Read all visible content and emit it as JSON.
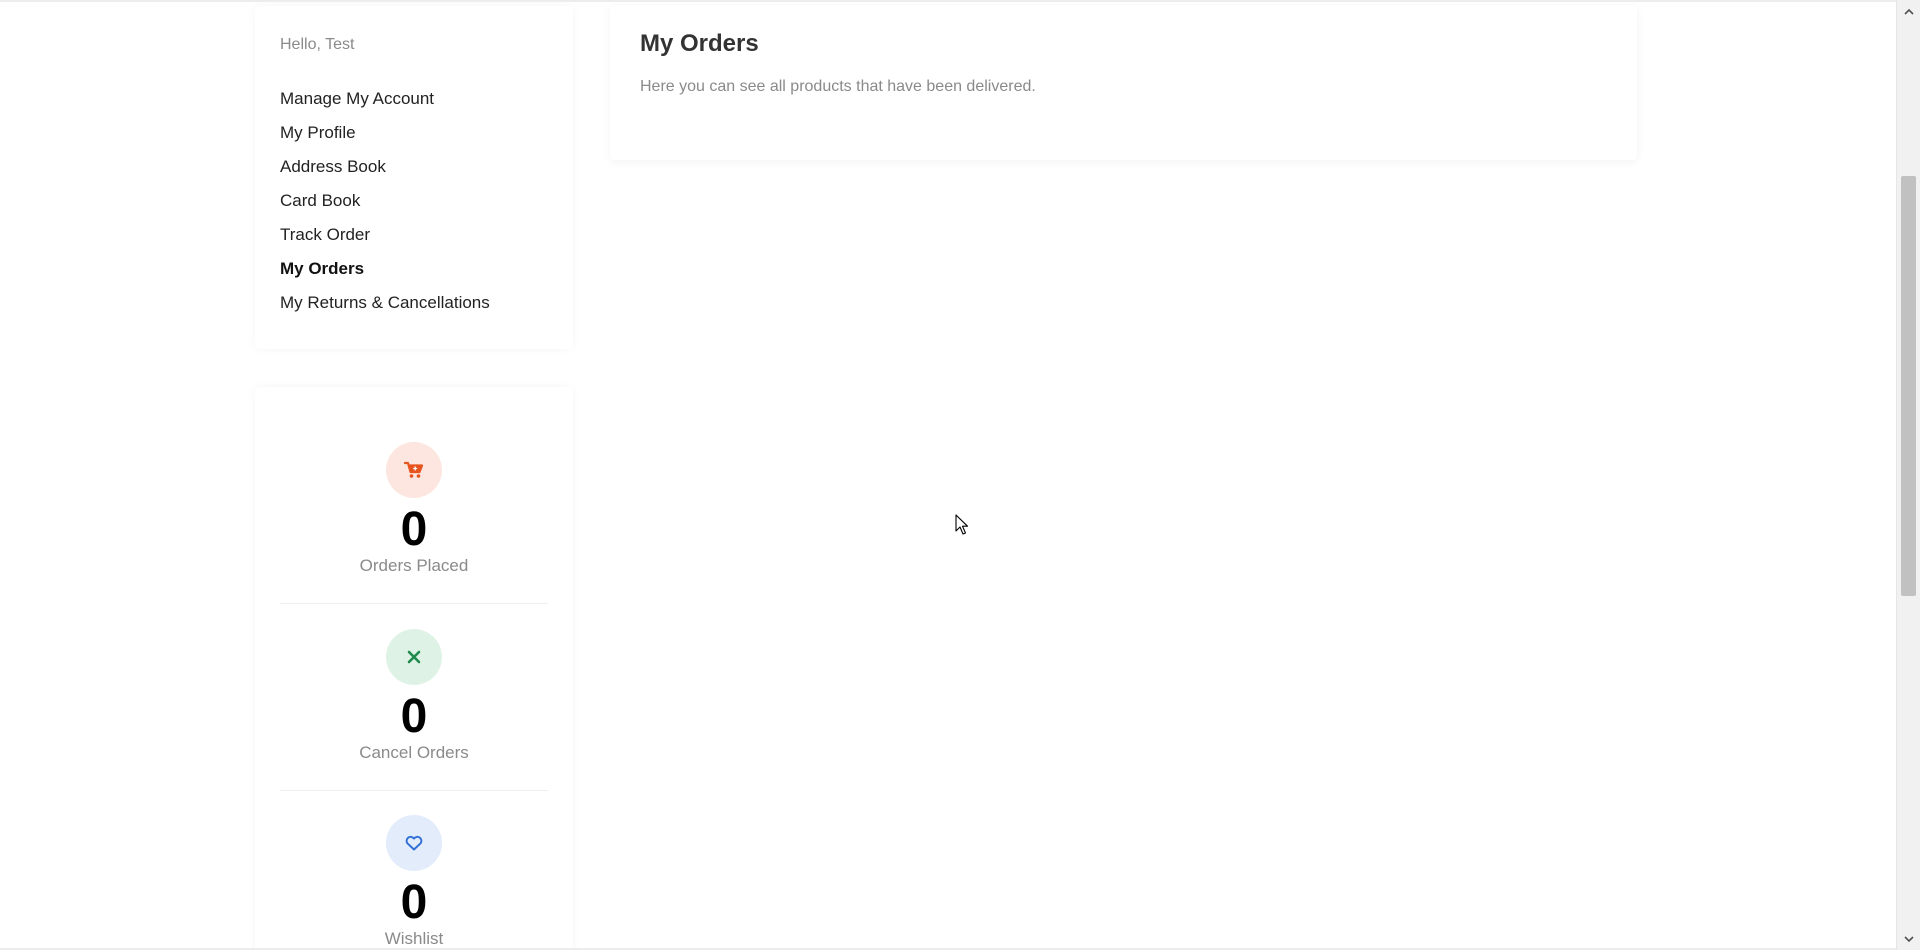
{
  "sidebar": {
    "greeting": "Hello, Test",
    "items": [
      {
        "label": "Manage My Account"
      },
      {
        "label": "My Profile"
      },
      {
        "label": "Address Book"
      },
      {
        "label": "Card Book"
      },
      {
        "label": "Track Order"
      },
      {
        "label": "My Orders",
        "active": true
      },
      {
        "label": "My Returns & Cancellations"
      }
    ]
  },
  "stats": [
    {
      "icon": "shopping-cart-icon",
      "value": "0",
      "label": "Orders Placed",
      "color": "#e8541e",
      "bg": "#fde6df"
    },
    {
      "icon": "close-icon",
      "value": "0",
      "label": "Cancel Orders",
      "color": "#1f8a4c",
      "bg": "#def3e6"
    },
    {
      "icon": "heart-icon",
      "value": "0",
      "label": "Wishlist",
      "color": "#2f6fd6",
      "bg": "#e2ecfb"
    }
  ],
  "main": {
    "title": "My Orders",
    "subtitle": "Here you can see all products that have been delivered."
  }
}
